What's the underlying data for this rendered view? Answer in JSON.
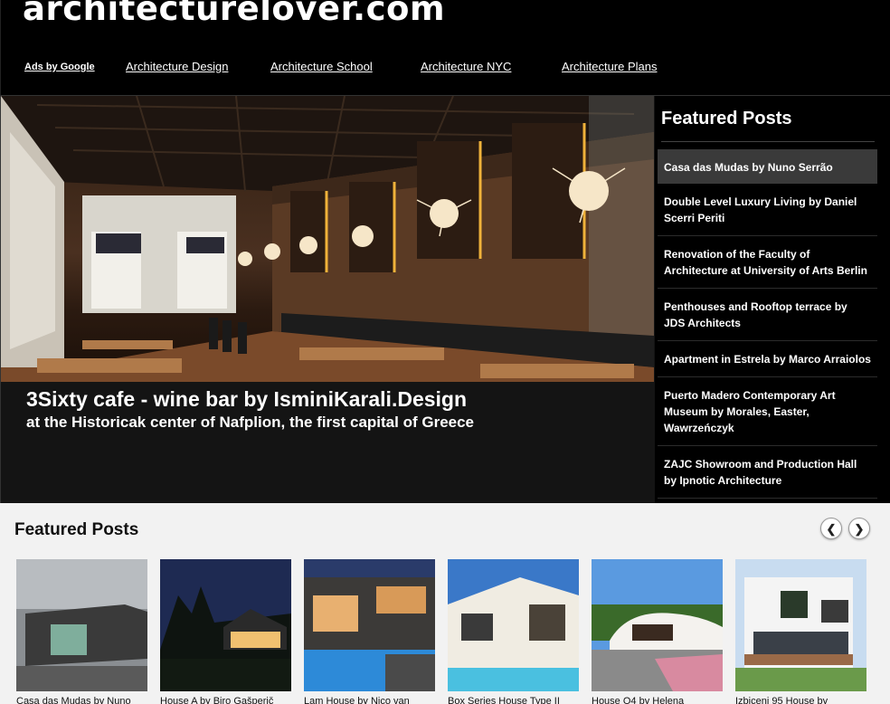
{
  "site": {
    "title": "architecturelover.com"
  },
  "nav": {
    "ads": "Ads by Google",
    "links": [
      "Architecture Design",
      "Architecture School",
      "Architecture NYC",
      "Architecture Plans"
    ]
  },
  "hero": {
    "title": "3Sixty cafe - wine bar by IsminiKarali.Design",
    "subtitle": "at the Historicak center of Nafplion, the first capital of Greece"
  },
  "sidebar": {
    "title": "Featured Posts",
    "items": [
      "Casa das Mudas by Nuno Serrão",
      "Double Level Luxury Living by Daniel Scerri Periti",
      "Renovation of the Faculty of Architecture at University of Arts Berlin",
      "Penthouses and Rooftop terrace by JDS Architects",
      "Apartment in Estrela by Marco Arraiolos",
      "Puerto Madero Contemporary Art Museum by Morales, Easter, Wawrzeńczyk",
      "ZAJC Showroom and Production Hall by Ipnotic Architecture"
    ],
    "active_index": 0
  },
  "carousel": {
    "title": "Featured Posts",
    "prev_icon": "chevron-left-icon",
    "next_icon": "chevron-right-icon",
    "items": [
      "Casa das Mudas by Nuno",
      "House A by Biro Gašperič",
      "Lam House by Nico van",
      "Box Series House Type II",
      "House O4 by Helena",
      "Izbiceni 95 House by"
    ]
  },
  "colors": {
    "background": "#000000",
    "carousel_bg": "#f2f2f2",
    "active_item": "#3a3a3a"
  }
}
